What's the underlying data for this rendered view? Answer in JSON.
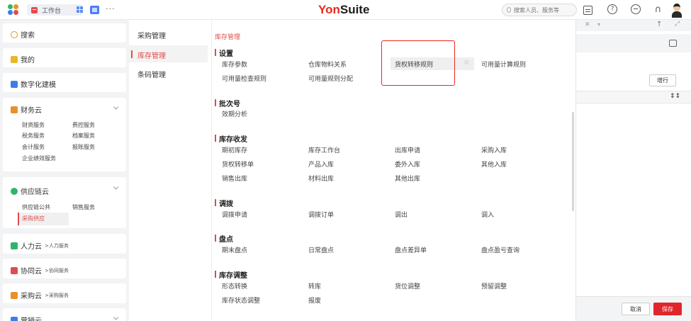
{
  "topbar": {
    "tab_label": "工作台",
    "brand_yon": "Yon",
    "brand_suite": "Suite",
    "search_placeholder": "搜索人员、服务等",
    "more": "···"
  },
  "sidebar": {
    "search": "搜索",
    "mine": "我的",
    "digital": "数字化建模",
    "finance": {
      "label": "财务云",
      "items": [
        "财资服务",
        "费控服务",
        "税务服务",
        "档案服务",
        "会计服务",
        "报账服务",
        "企业绩效服务"
      ]
    },
    "supply": {
      "label": "供应链云",
      "items": [
        "供应链公共",
        "销售服务"
      ],
      "active": "采购供应"
    },
    "hr": {
      "label": "人力云",
      "sub": "人力服务"
    },
    "collab": {
      "label": "协同云",
      "sub": "协同服务"
    },
    "purchase": {
      "label": "采购云",
      "sub": "采购服务"
    },
    "marketing": {
      "label": "营销云"
    },
    "colors": {
      "orange": "#e8912c",
      "blue": "#3b7ee8",
      "green": "#2fb56a",
      "red": "#e14c4c"
    }
  },
  "midcol": {
    "items": [
      "采购管理",
      "库存管理",
      "条码管理"
    ],
    "active_index": 1
  },
  "main": {
    "breadcrumb": "库存管理",
    "sections": [
      {
        "title": "设置",
        "links": [
          "库存参数",
          "仓库物料关系",
          "货权转移规则",
          "可用量计算规则",
          "可用量检查规则",
          "可用量规则分配"
        ]
      },
      {
        "title": "批次号",
        "links": [
          "效期分析"
        ]
      },
      {
        "title": "库存收发",
        "links": [
          "期初库存",
          "库存工作台",
          "出库申请",
          "采购入库",
          "货权转移单",
          "产品入库",
          "委外入库",
          "其他入库",
          "销售出库",
          "材料出库",
          "其他出库"
        ]
      },
      {
        "title": "调拨",
        "links": [
          "调拨申请",
          "调拨订单",
          "调出",
          "调入"
        ]
      },
      {
        "title": "盘点",
        "links": [
          "期末盘点",
          "日常盘点",
          "盘点差异单",
          "盘点盈亏查询"
        ]
      },
      {
        "title": "库存调整",
        "links": [
          "形态转换",
          "转库",
          "货位调整",
          "预留调整",
          "库存状态调整",
          "报废"
        ]
      }
    ],
    "highlighted": "货权转移规则",
    "accent": "#e14c4c",
    "frame_color": "#e8291c"
  },
  "rpanel": {
    "add_row": "增行",
    "cancel": "取消",
    "save": "保存",
    "save_color": "#e0262b"
  }
}
